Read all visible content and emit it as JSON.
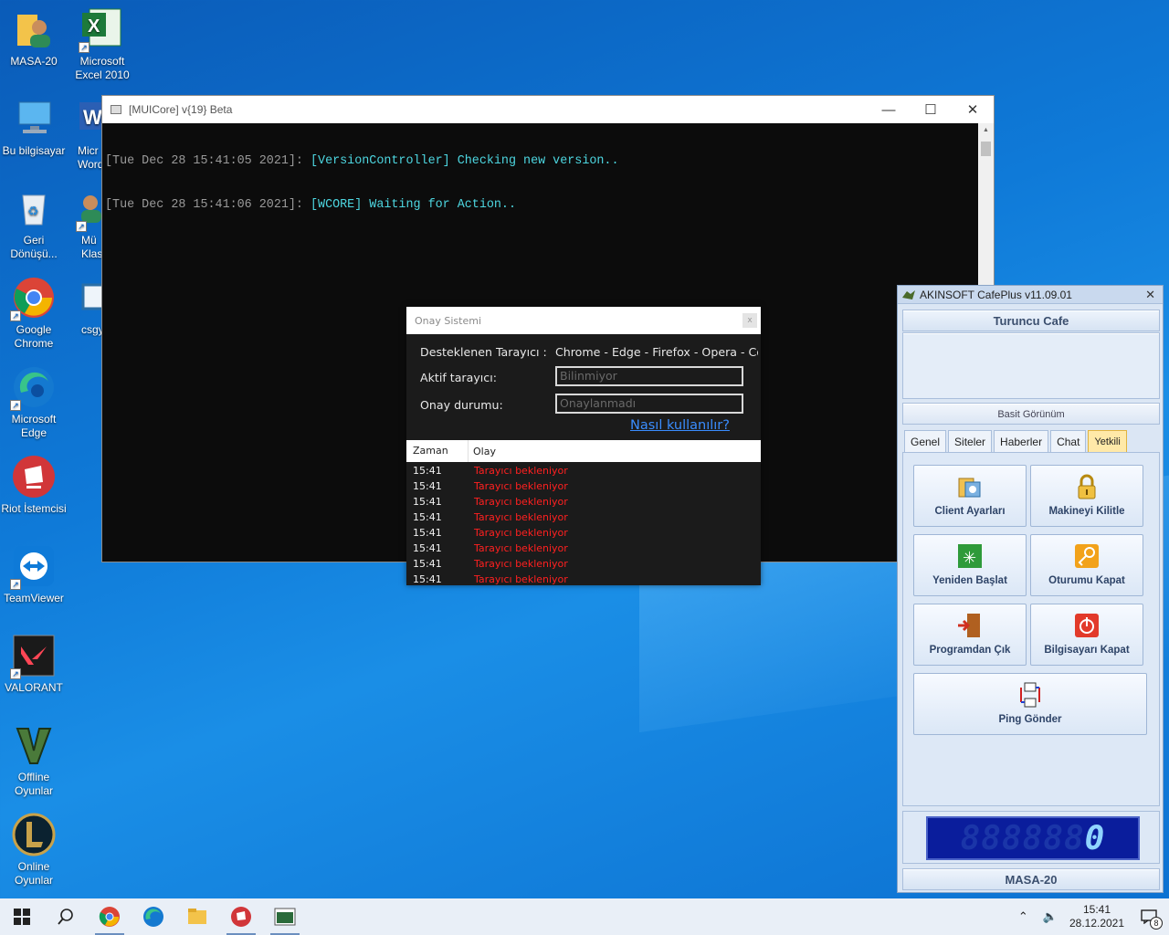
{
  "desktop_icons": [
    {
      "id": "masa20",
      "label": "MASA-20"
    },
    {
      "id": "excel",
      "label": "Microsoft Excel 2010"
    },
    {
      "id": "bu-bilgisayar",
      "label": "Bu bilgisayar"
    },
    {
      "id": "word",
      "label": "Micr Word"
    },
    {
      "id": "geri",
      "label": "Geri Dönüşü..."
    },
    {
      "id": "muz",
      "label": "Mü Klas"
    },
    {
      "id": "chrome",
      "label": "Google Chrome"
    },
    {
      "id": "csgo",
      "label": "csgy"
    },
    {
      "id": "edge",
      "label": "Microsoft Edge"
    },
    {
      "id": "riot",
      "label": "Riot İstemcisi"
    },
    {
      "id": "teamviewer",
      "label": "TeamViewer"
    },
    {
      "id": "valorant",
      "label": "VALORANT"
    },
    {
      "id": "offline",
      "label": "Offline Oyunlar"
    },
    {
      "id": "online",
      "label": "Online Oyunlar"
    }
  ],
  "console": {
    "title": "[MUICore] v{19} Beta",
    "lines": [
      {
        "ts": "[Tue Dec 28 15:41:05 2021]:",
        "msg": " [VersionController] Checking new version.."
      },
      {
        "ts": "[Tue Dec 28 15:41:06 2021]:",
        "msg": " [WCORE] Waiting for Action.."
      }
    ],
    "controls": {
      "minimize": "—",
      "maximize": "☐",
      "close": "✕"
    }
  },
  "onay": {
    "title": "Onay Sistemi",
    "close": "x",
    "supported_label": "Desteklenen Tarayıcı :",
    "supported_value": "Chrome - Edge - Firefox - Opera - Coc",
    "active_label": "Aktif tarayıcı:",
    "active_value": "Bilinmiyor",
    "status_label": "Onay durumu:",
    "status_value": "Onaylanmadı",
    "help_link": "Nasıl kullanılır?",
    "table": {
      "headers": [
        "Zaman",
        "Olay"
      ],
      "rows": [
        [
          "15:41",
          "Tarayıcı bekleniyor"
        ],
        [
          "15:41",
          "Tarayıcı bekleniyor"
        ],
        [
          "15:41",
          "Tarayıcı bekleniyor"
        ],
        [
          "15:41",
          "Tarayıcı bekleniyor"
        ],
        [
          "15:41",
          "Tarayıcı bekleniyor"
        ],
        [
          "15:41",
          "Tarayıcı bekleniyor"
        ],
        [
          "15:41",
          "Tarayıcı bekleniyor"
        ],
        [
          "15:41",
          "Tarayıcı bekleniyor"
        ]
      ]
    }
  },
  "cafeplus": {
    "title": "AKINSOFT CafePlus v11.09.01",
    "close": "✕",
    "cafe_name": "Turuncu Cafe",
    "view_mode": "Basit Görünüm",
    "tabs": [
      "Genel",
      "Siteler",
      "Haberler",
      "Chat",
      "Yetkili"
    ],
    "active_tab": "Yetkili",
    "buttons": [
      {
        "label": "Client Ayarları",
        "icon": "settings-icon"
      },
      {
        "label": "Makineyi Kilitle",
        "icon": "lock-icon"
      },
      {
        "label": "Yeniden Başlat",
        "icon": "restart-icon"
      },
      {
        "label": "Oturumu Kapat",
        "icon": "key-icon"
      },
      {
        "label": "Programdan Çık",
        "icon": "exit-door-icon"
      },
      {
        "label": "Bilgisayarı Kapat",
        "icon": "power-icon"
      },
      {
        "label": "Ping Gönder",
        "icon": "network-icon"
      }
    ],
    "counter_dim": "888888",
    "counter_lit": "0",
    "machine": "MASA-20"
  },
  "taskbar": {
    "time": "15:41",
    "date": "28.12.2021",
    "notifications": "8"
  }
}
